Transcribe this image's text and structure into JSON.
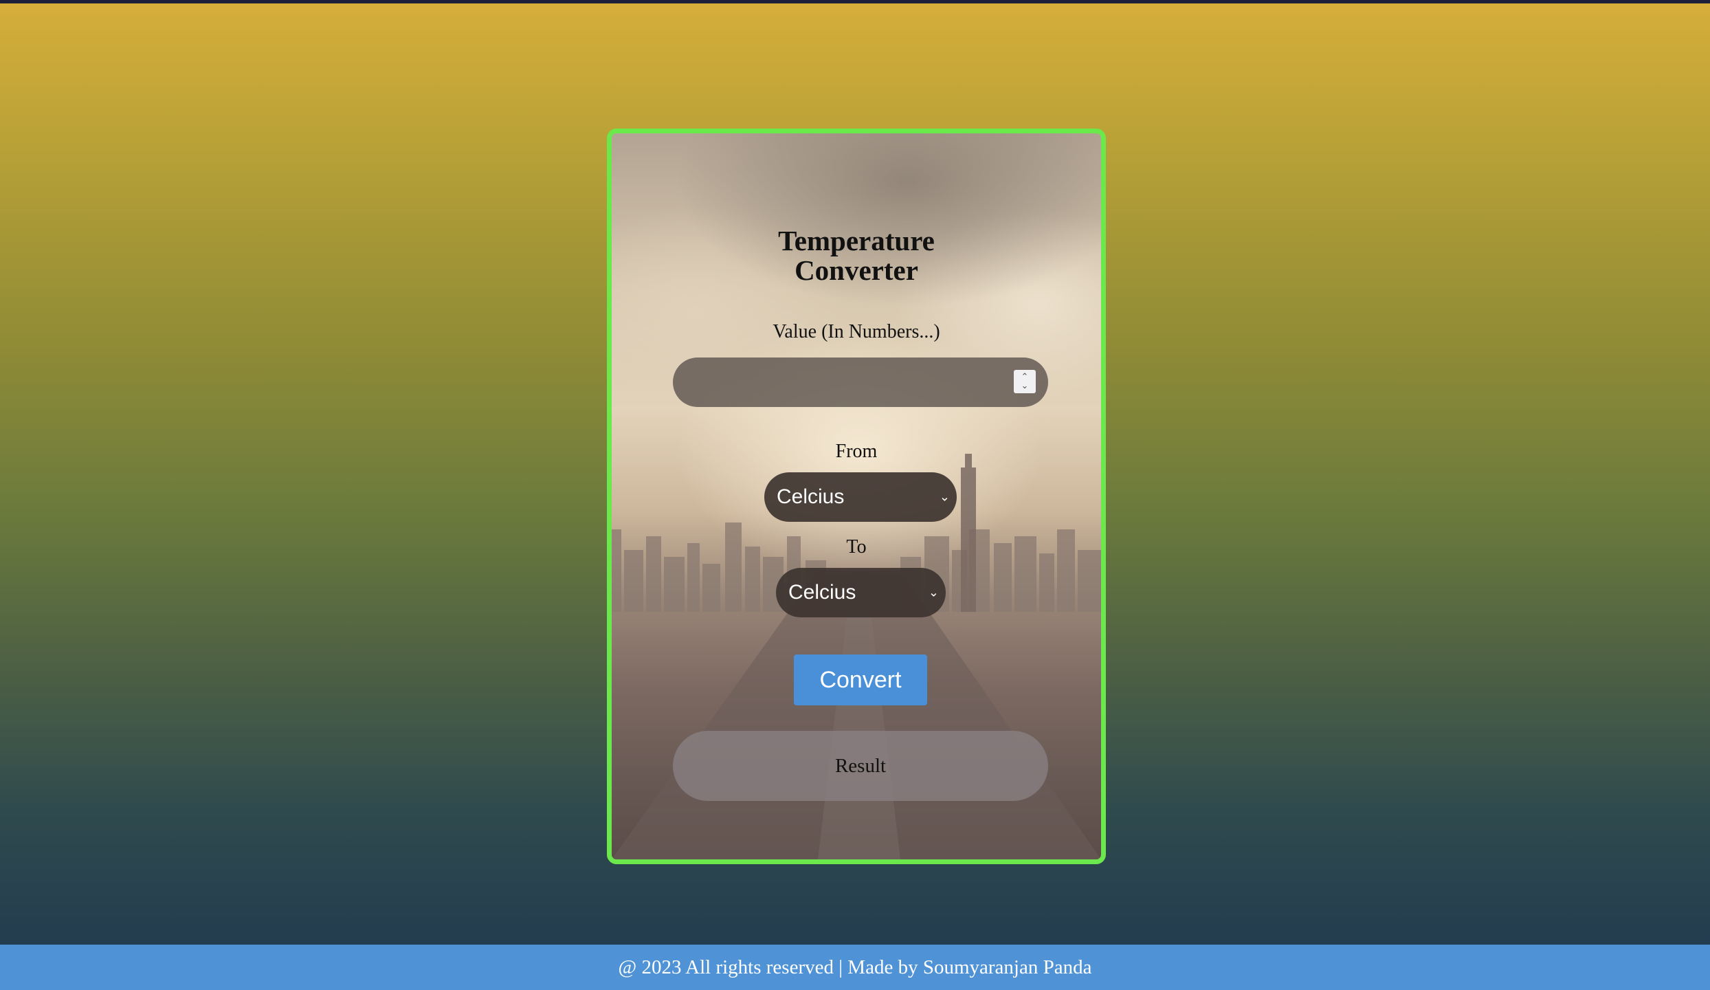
{
  "app": {
    "title": "Temperature\nConverter"
  },
  "form": {
    "value_label": "Value (In Numbers...)",
    "value_input": "",
    "from_label": "From",
    "from_selected": "Celcius",
    "to_label": "To",
    "to_selected": "Celcius",
    "convert_label": "Convert",
    "result_text": "Result"
  },
  "footer": {
    "text": "@ 2023 All rights reserved | Made by Soumyaranjan Panda"
  },
  "icons": {
    "spinner": "number-spinner-icon",
    "dropdown": "chevron-down-icon"
  },
  "colors": {
    "card_border": "#6be84b",
    "convert_button": "#4a90d9",
    "footer_bg": "#4f93d6"
  }
}
